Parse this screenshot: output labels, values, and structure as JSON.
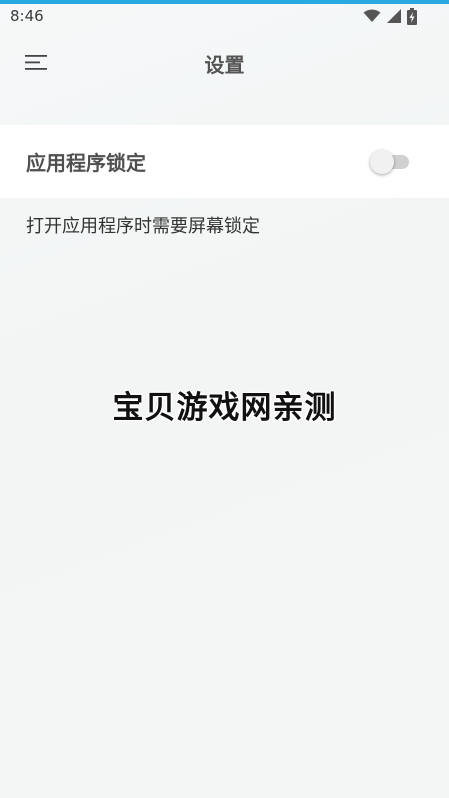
{
  "status_bar": {
    "time": "8:46",
    "icons": [
      "wifi-icon",
      "signal-icon",
      "battery-charging-icon"
    ]
  },
  "app_bar": {
    "menu_icon": "menu-icon",
    "title": "设置"
  },
  "settings": {
    "app_lock": {
      "label": "应用程序锁定",
      "enabled": false,
      "description": "打开应用程序时需要屏幕锁定"
    }
  },
  "watermark": "宝贝游戏网亲测",
  "colors": {
    "accent": "#29a9e1",
    "row_background": "#ffffff",
    "toggle_off_track": "#d0d0d0"
  }
}
